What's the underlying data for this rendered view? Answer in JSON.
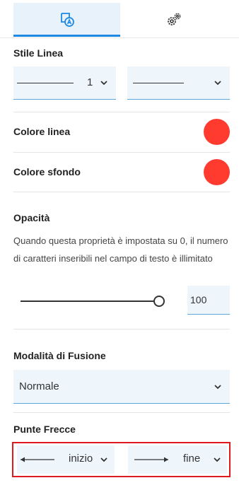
{
  "tabs": [
    {
      "name": "text-style-tab",
      "icon": "text-style-icon",
      "active": true
    },
    {
      "name": "settings-tab",
      "icon": "settings-gears-icon",
      "active": false
    }
  ],
  "line_style": {
    "title": "Stile Linea",
    "width_value": "1"
  },
  "line_color": {
    "label": "Colore linea",
    "color": "#ff3b2f"
  },
  "background_color": {
    "label": "Colore sfondo",
    "color": "#ff3b2f"
  },
  "opacity": {
    "title": "Opacità",
    "description": "Quando questa proprietà è impostata su 0, il numero di caratteri inseribili nel campo di testo è illimitato",
    "value": "100",
    "slider_fraction": 1.0
  },
  "blend_mode": {
    "title": "Modalità di Fusione",
    "value": "Normale"
  },
  "arrowheads": {
    "title": "Punte Frecce",
    "start_value": "inizio",
    "end_value": "fine"
  },
  "colors": {
    "accent": "#1e88e5",
    "field_bg": "#eef6fc",
    "swatch": "#ff3b2f",
    "highlight_frame": "#e0191f"
  }
}
